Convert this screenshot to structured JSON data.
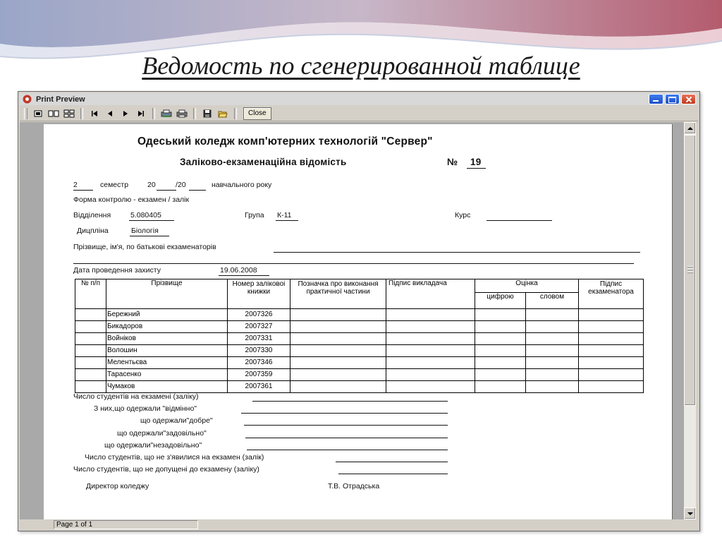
{
  "slide": {
    "title": "Ведомость по сгенерированной таблице"
  },
  "window": {
    "title": "Print Preview",
    "close_label": "Close",
    "status": "Page 1 of 1",
    "icons": [
      "one-page-icon",
      "two-page-icon",
      "multi-page-icon",
      "first-page-icon",
      "prev-page-icon",
      "next-page-icon",
      "last-page-icon",
      "printer-setup-icon",
      "print-icon",
      "save-icon",
      "open-icon"
    ]
  },
  "report": {
    "college": "Одеський коледж комп'ютерних технологій \"Сервер\"",
    "title": "Заліково-екзаменаційна відомість",
    "number_sign": "№",
    "number": "19",
    "semester_value": "2",
    "semester_text": "семестр",
    "year_prefix": "20",
    "year_sep": "/20",
    "year_suffix": "навчального року",
    "control_form": "Форма контролю - екзамен / залік",
    "dept_label": "Відділення",
    "dept_value": "5.080405",
    "group_label": "Група",
    "group_value": "К-11",
    "course_label": "Курс",
    "discipline_label": "Дицпліна",
    "discipline_value": "Біологія",
    "examiners_label": "Прізвище, ім'я, по батькові екзаменаторів",
    "date_label": "Дата проведення захисту",
    "date_value": "19.06.2008",
    "headers": {
      "num": "№ п/п",
      "surname": "Прізвище",
      "book": "Номер заліковоі книжки",
      "mark": "Позначка про виконання практичної частини",
      "teacher_sign": "Підпис викладача",
      "grade": "Оцінка",
      "grade_digits": "цифрою",
      "grade_words": "словом",
      "examiner_sign": "Підпис екзаменатора"
    },
    "students": [
      {
        "surname": "Бережний",
        "book": "2007326"
      },
      {
        "surname": "Бикадоров",
        "book": "2007327"
      },
      {
        "surname": "Войніков",
        "book": "2007331"
      },
      {
        "surname": "Волошин",
        "book": "2007330"
      },
      {
        "surname": "Мелентьєва",
        "book": "2007346"
      },
      {
        "surname": "Тарасенко",
        "book": "2007359"
      },
      {
        "surname": "Чумаков",
        "book": "2007361"
      }
    ],
    "summary": [
      "Число студентів на екзамені (заліку)",
      "З них,що одержали \"відмінно\"",
      "що одержали\"добре\"",
      "що одержали\"задовільно\"",
      "що одержали\"незадовільно\"",
      "Число студентів, що не з'явилися на екзамен (залік)",
      "Число студентів, що не допущені до екзамену (заліку)"
    ],
    "director_label": "Директор коледжу",
    "director_name": "Т.В. Отрадська"
  }
}
